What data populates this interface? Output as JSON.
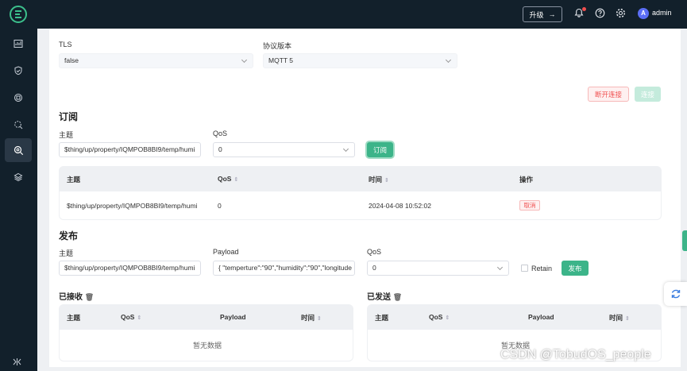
{
  "topbar": {
    "upgrade_label": "升级",
    "upgrade_arrow": "→",
    "username": "admin",
    "avatar_letter": "A"
  },
  "connection": {
    "tls_label": "TLS",
    "tls_value": "false",
    "protocol_label": "协议版本",
    "protocol_value": "MQTT 5",
    "disconnect_label": "断开连接",
    "connect_label": "连接"
  },
  "subscribe": {
    "title": "订阅",
    "topic_label": "主题",
    "topic_value": "$thing/up/property/IQMPOB8BI9/temp/humi",
    "qos_label": "QoS",
    "qos_value": "0",
    "subscribe_label": "订阅",
    "columns": [
      "主题",
      "QoS",
      "时间",
      "操作"
    ],
    "rows": [
      {
        "topic": "$thing/up/property/IQMPOB8BI9/temp/humi",
        "qos": "0",
        "time": "2024-04-08 10:52:02",
        "action": "取消"
      }
    ]
  },
  "publish": {
    "title": "发布",
    "topic_label": "主题",
    "topic_value": "$thing/up/property/IQMPOB8BI9/temp/humi",
    "payload_label": "Payload",
    "payload_value": "{ \"temperture\":\"90\",\"humidity\":\"90\",\"longitude",
    "qos_label": "QoS",
    "qos_value": "0",
    "retain_label": "Retain",
    "publish_label": "发布"
  },
  "received": {
    "title": "已接收",
    "columns": [
      "主题",
      "QoS",
      "Payload",
      "时间"
    ],
    "empty": "暂无数据"
  },
  "sent": {
    "title": "已发送",
    "columns": [
      "主题",
      "QoS",
      "Payload",
      "时间"
    ],
    "empty": "暂无数据"
  },
  "watermark": "CSDN @TobudOS_people",
  "colors": {
    "sidebar": "#12202b",
    "accent": "#3cb489",
    "danger": "#f04e4e"
  }
}
